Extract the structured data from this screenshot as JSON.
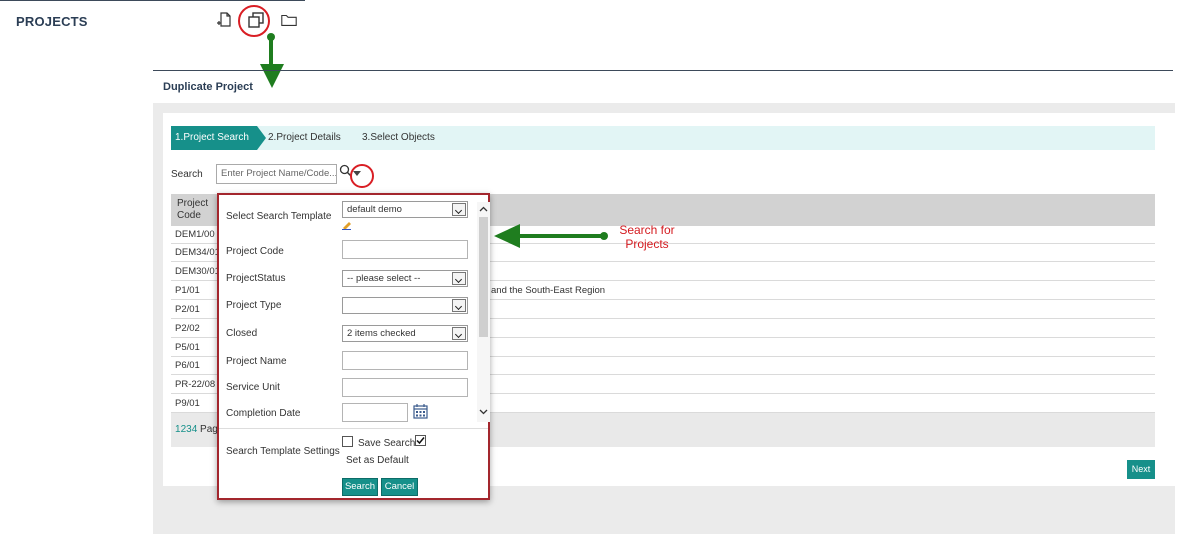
{
  "app": {
    "title": "PROJECTS"
  },
  "toolbar": {
    "icons": [
      "new-project-icon",
      "duplicate-project-icon",
      "folder-icon"
    ]
  },
  "section": {
    "title": "Duplicate Project"
  },
  "wizard": {
    "steps": [
      "1.Project Search",
      "2.Project Details",
      "3.Select Objects"
    ]
  },
  "search": {
    "label": "Search",
    "placeholder": "Enter Project Name/Code..."
  },
  "table": {
    "header_code": [
      "Project",
      "Code"
    ],
    "rows": [
      {
        "code": "DEM1/00",
        "desc": ""
      },
      {
        "code": "DEM34/01",
        "desc": ""
      },
      {
        "code": "DEM30/01",
        "desc": ""
      },
      {
        "code": "P1/01",
        "desc": "and the South-East Region"
      },
      {
        "code": "P2/01",
        "desc": ""
      },
      {
        "code": "P2/02",
        "desc": ""
      },
      {
        "code": "P5/01",
        "desc": ""
      },
      {
        "code": "P6/01",
        "desc": ""
      },
      {
        "code": "PR-22/08",
        "desc": ""
      },
      {
        "code": "P9/01",
        "desc": ""
      }
    ]
  },
  "pager": {
    "pages": [
      "1",
      "2",
      "3",
      "4"
    ],
    "suffix": " Pag"
  },
  "next_label": "Next",
  "popup": {
    "select_template_label": "Select Search Template",
    "template_value": "default demo",
    "project_code_label": "Project Code",
    "project_status_label": "ProjectStatus",
    "project_status_value": "-- please select --",
    "project_type_label": "Project Type",
    "project_type_value": "",
    "closed_label": "Closed",
    "closed_value": "2 items checked",
    "project_name_label": "Project Name",
    "service_unit_label": "Service Unit",
    "completion_date_label": "Completion Date",
    "template_settings_label": "Search Template Settings",
    "save_search_label": "Save Search",
    "save_search_checked": false,
    "set_default_label": "Set as Default",
    "set_default_checked": true,
    "search_button": "Search",
    "cancel_button": "Cancel"
  },
  "annotation": {
    "text": "Search for Projects"
  },
  "colors": {
    "accent": "#16908a",
    "annotation_red": "#d41b20",
    "annotation_green": "#1f7d1f",
    "heading": "#2b3e55"
  }
}
